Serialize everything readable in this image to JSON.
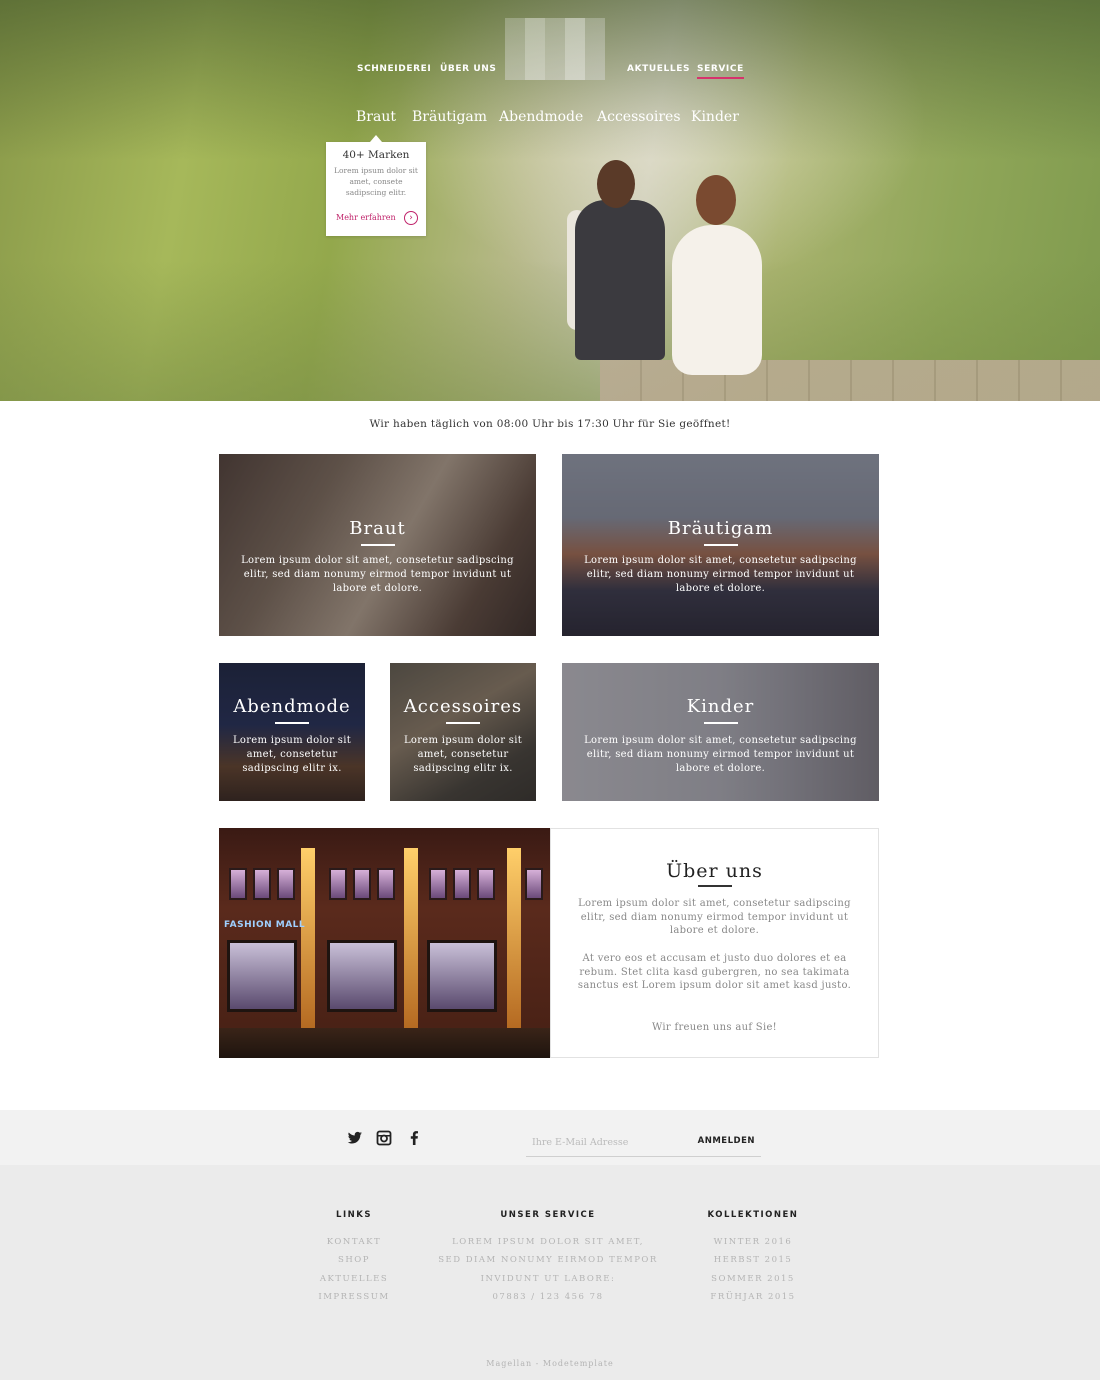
{
  "nav": {
    "items": [
      "SCHNEIDEREI",
      "ÜBER UNS",
      "AKTUELLES",
      "SERVICE"
    ],
    "active": "SERVICE",
    "accent_color": "#d6336c"
  },
  "subnav": {
    "items": [
      "Braut",
      "Bräutigam",
      "Abendmode",
      "Accessoires",
      "Kinder"
    ]
  },
  "dropdown": {
    "title": "40+ Marken",
    "text": "Lorem ipsum dolor sit amet, consete sadipscing elitr.",
    "more_label": "Mehr erfahren",
    "arrow_icon": "chevron-right-circle-icon",
    "link_color": "#c0246b"
  },
  "opening_hours": "Wir haben täglich von 08:00 Uhr bis 17:30 Uhr für Sie geöffnet!",
  "tiles": {
    "braut": {
      "title": "Braut",
      "text": "Lorem ipsum dolor sit amet, consetetur sadipscing elitr, sed diam nonumy eirmod tempor invidunt ut labore et dolore."
    },
    "braeutigam": {
      "title": "Bräutigam",
      "text": "Lorem ipsum dolor sit amet, consetetur sadipscing elitr, sed diam nonumy eirmod tempor invidunt ut labore et dolore."
    },
    "abendmode": {
      "title": "Abendmode",
      "text": "Lorem ipsum dolor sit amet, consetetur sadipscing elitr ix."
    },
    "accessoires": {
      "title": "Accessoires",
      "text": "Lorem ipsum dolor sit amet, consetetur sadipscing elitr ix."
    },
    "kinder": {
      "title": "Kinder",
      "text": "Lorem ipsum dolor sit amet, consetetur sadipscing elitr, sed diam nonumy eirmod tempor invidunt ut labore et dolore."
    }
  },
  "about": {
    "image_sign": "FASHION MALL",
    "title": "Über uns",
    "p1": "Lorem ipsum dolor sit amet, consetetur sadipscing elitr, sed diam nonumy eirmod tempor invidunt ut labore et dolore.",
    "p2": "At vero eos et accusam et justo duo dolores et ea rebum. Stet clita kasd gubergren, no sea takimata sanctus est Lorem ipsum dolor sit amet kasd justo.",
    "p3": "Wir freuen uns auf Sie!"
  },
  "newsletter": {
    "placeholder": "Ihre E-Mail Adresse",
    "submit_label": "ANMELDEN"
  },
  "social_icons": [
    "twitter-icon",
    "instagram-icon",
    "facebook-icon"
  ],
  "footer": {
    "links": {
      "heading": "LINKS",
      "items": [
        "KONTAKT",
        "SHOP",
        "AKTUELLES",
        "IMPRESSUM"
      ]
    },
    "service": {
      "heading": "UNSER SERVICE",
      "items": [
        "LOREM IPSUM DOLOR SIT AMET,",
        "SED DIAM NONUMY EIRMOD TEMPOR",
        "INVIDUNT UT LABORE:",
        "07883 / 123 456 78"
      ]
    },
    "kollektionen": {
      "heading": "KOLLEKTIONEN",
      "items": [
        "WINTER 2016",
        "HERBST 2015",
        "SOMMER 2015",
        "FRÜHJAR 2015"
      ]
    },
    "copyright": "Magellan - Modetemplate"
  }
}
